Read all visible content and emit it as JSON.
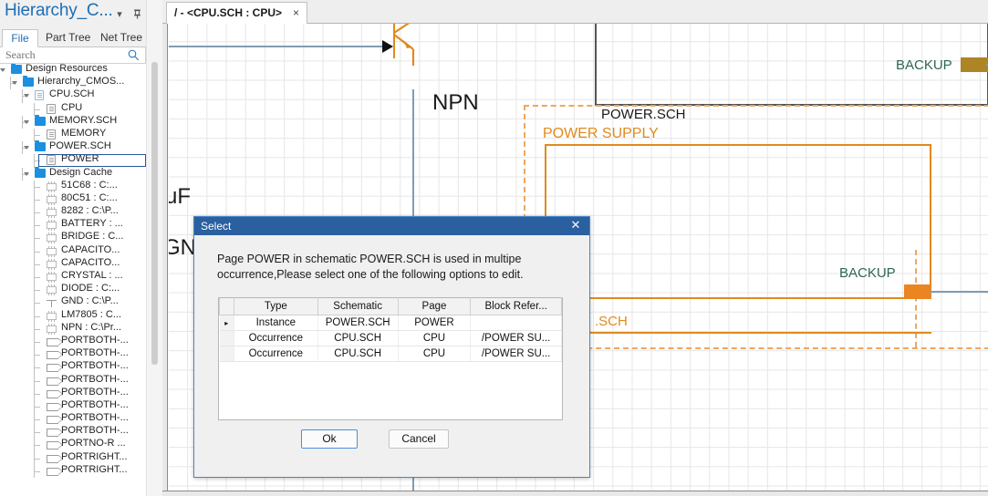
{
  "panel": {
    "title": "Hierarchy_C...",
    "menu_icon": "chevron-down-icon",
    "pin_icon": "pin-icon",
    "close_icon": "close-icon",
    "tabs": [
      {
        "label": "File",
        "active": true
      },
      {
        "label": "Part Tree",
        "active": false
      },
      {
        "label": "Net Tree",
        "active": false
      }
    ],
    "search": {
      "placeholder": "Search",
      "value": "",
      "icon": "search-icon"
    },
    "tree": [
      {
        "label": "Design Resources",
        "depth": 0,
        "icon": "folder-icon",
        "expander": "open",
        "selected": false
      },
      {
        "label": "Hierarchy_CMOS...",
        "depth": 1,
        "icon": "folder-icon",
        "expander": "open",
        "selected": false
      },
      {
        "label": "CPU.SCH",
        "depth": 2,
        "icon": "doc-blue-icon",
        "expander": "open",
        "selected": false
      },
      {
        "label": "CPU",
        "depth": 3,
        "icon": "doc-gray-icon",
        "expander": "none",
        "selected": false
      },
      {
        "label": "MEMORY.SCH",
        "depth": 2,
        "icon": "folder-icon",
        "expander": "open",
        "selected": false
      },
      {
        "label": "MEMORY",
        "depth": 3,
        "icon": "doc-gray-icon",
        "expander": "none",
        "selected": false
      },
      {
        "label": "POWER.SCH",
        "depth": 2,
        "icon": "folder-icon",
        "expander": "open",
        "selected": false
      },
      {
        "label": "POWER",
        "depth": 3,
        "icon": "doc-gray-icon",
        "expander": "none",
        "selected": true
      },
      {
        "label": "Design Cache",
        "depth": 2,
        "icon": "folder-icon",
        "expander": "open",
        "selected": false
      },
      {
        "label": "51C68 : C:...",
        "depth": 3,
        "icon": "chip-icon",
        "expander": "none",
        "selected": false
      },
      {
        "label": "80C51 : C:...",
        "depth": 3,
        "icon": "chip-icon",
        "expander": "none",
        "selected": false
      },
      {
        "label": "8282 : C:\\P...",
        "depth": 3,
        "icon": "chip-icon",
        "expander": "none",
        "selected": false
      },
      {
        "label": "BATTERY : ...",
        "depth": 3,
        "icon": "chip-icon",
        "expander": "none",
        "selected": false
      },
      {
        "label": "BRIDGE : C...",
        "depth": 3,
        "icon": "chip-icon",
        "expander": "none",
        "selected": false
      },
      {
        "label": "CAPACITO...",
        "depth": 3,
        "icon": "chip-icon",
        "expander": "none",
        "selected": false
      },
      {
        "label": "CAPACITO...",
        "depth": 3,
        "icon": "chip-icon",
        "expander": "none",
        "selected": false
      },
      {
        "label": "CRYSTAL : ...",
        "depth": 3,
        "icon": "chip-icon",
        "expander": "none",
        "selected": false
      },
      {
        "label": "DIODE : C:...",
        "depth": 3,
        "icon": "chip-icon",
        "expander": "none",
        "selected": false
      },
      {
        "label": "GND : C:\\P...",
        "depth": 3,
        "icon": "gnd-icon",
        "expander": "none",
        "selected": false
      },
      {
        "label": "LM7805 : C...",
        "depth": 3,
        "icon": "chip-icon",
        "expander": "none",
        "selected": false
      },
      {
        "label": "NPN : C:\\Pr...",
        "depth": 3,
        "icon": "chip-icon",
        "expander": "none",
        "selected": false
      },
      {
        "label": "PORTBOTH-...",
        "depth": 3,
        "icon": "port-icon",
        "expander": "none",
        "selected": false
      },
      {
        "label": "PORTBOTH-...",
        "depth": 3,
        "icon": "port-icon",
        "expander": "none",
        "selected": false
      },
      {
        "label": "PORTBOTH-...",
        "depth": 3,
        "icon": "port-icon",
        "expander": "none",
        "selected": false
      },
      {
        "label": "PORTBOTH-...",
        "depth": 3,
        "icon": "port-icon",
        "expander": "none",
        "selected": false
      },
      {
        "label": "PORTBOTH-...",
        "depth": 3,
        "icon": "port-icon",
        "expander": "none",
        "selected": false
      },
      {
        "label": "PORTBOTH-...",
        "depth": 3,
        "icon": "port-icon",
        "expander": "none",
        "selected": false
      },
      {
        "label": "PORTBOTH-...",
        "depth": 3,
        "icon": "port-icon",
        "expander": "none",
        "selected": false
      },
      {
        "label": "PORTBOTH-...",
        "depth": 3,
        "icon": "port-icon",
        "expander": "none",
        "selected": false
      },
      {
        "label": "PORTNO-R ...",
        "depth": 3,
        "icon": "port-icon",
        "expander": "none",
        "selected": false
      },
      {
        "label": "PORTRIGHT...",
        "depth": 3,
        "icon": "port-icon",
        "expander": "none",
        "selected": false
      },
      {
        "label": "PORTRIGHT...",
        "depth": 3,
        "icon": "port-icon",
        "expander": "none",
        "selected": false
      }
    ]
  },
  "editor": {
    "tab_label": "/ - <CPU.SCH : CPU>",
    "tab_close": "×"
  },
  "schematic": {
    "labels": {
      "npn": "NPN",
      "uf": "uF",
      "gnd": "GND",
      "power_sch": "POWER.SCH",
      "power_supply": "POWER SUPPLY",
      "sch_partial": ".SCH",
      "backup_top": "BACKUP",
      "backup_mid": "BACKUP"
    },
    "colors": {
      "wire": "#7f9cb5",
      "component": "#e08a1e",
      "block_dashed": "#f0a65c",
      "port_top": "#ad8524",
      "port_mid": "#ea8521",
      "label_green": "#2e6657"
    }
  },
  "dialog": {
    "title": "Select",
    "close_icon": "close-icon",
    "message": "Page POWER in schematic POWER.SCH is used in multipe occurrence,Please select one of the following options to edit.",
    "table": {
      "columns": [
        "Type",
        "Schematic",
        "Page",
        "Block Refer..."
      ],
      "rows": [
        {
          "marker": "▸",
          "Type": "Instance",
          "Schematic": "POWER.SCH",
          "Page": "POWER",
          "Block": ""
        },
        {
          "marker": "",
          "Type": "Occurrence",
          "Schematic": "CPU.SCH",
          "Page": "CPU",
          "Block": "/POWER SU..."
        },
        {
          "marker": "",
          "Type": "Occurrence",
          "Schematic": "CPU.SCH",
          "Page": "CPU",
          "Block": "/POWER SU..."
        }
      ]
    },
    "buttons": {
      "ok": "Ok",
      "cancel": "Cancel"
    }
  }
}
